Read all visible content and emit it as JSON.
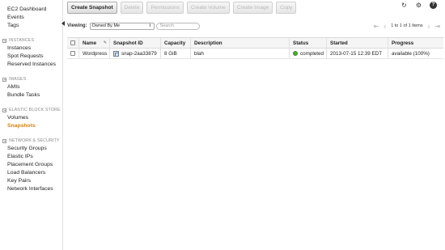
{
  "sidebar": {
    "top_items": [
      {
        "label": "EC2 Dashboard"
      },
      {
        "label": "Events"
      },
      {
        "label": "Tags"
      }
    ],
    "sections": [
      {
        "title": "INSTANCES",
        "items": [
          "Instances",
          "Spot Requests",
          "Reserved Instances"
        ]
      },
      {
        "title": "IMAGES",
        "items": [
          "AMIs",
          "Bundle Tasks"
        ]
      },
      {
        "title": "ELASTIC BLOCK STORE",
        "items": [
          "Volumes",
          "Snapshots"
        ]
      },
      {
        "title": "NETWORK & SECURITY",
        "items": [
          "Security Groups",
          "Elastic IPs",
          "Placement Groups",
          "Load Balancers",
          "Key Pairs",
          "Network Interfaces"
        ]
      }
    ],
    "active_item": "Snapshots"
  },
  "toolbar": {
    "create_snapshot": "Create Snapshot",
    "delete": "Delete",
    "permissions": "Permissions",
    "create_volume": "Create Volume",
    "create_image": "Create Image",
    "copy": "Copy",
    "icons": [
      "refresh-icon",
      "gear-icon",
      "help-icon"
    ],
    "help_glyph": "?"
  },
  "filter": {
    "viewing_label": "Viewing:",
    "viewing_value": "Owned By Me",
    "search_placeholder": "Search",
    "pager_text": "1 to 1 of 1 Items"
  },
  "table": {
    "columns": [
      "Name",
      "Snapshot ID",
      "Capacity",
      "Description",
      "Status",
      "Started",
      "Progress"
    ],
    "rows": [
      {
        "name": "Wordpress",
        "snapshot_id": "snap-2aa33879",
        "capacity": "8 GiB",
        "description": "blah",
        "status": "completed",
        "started": "2013-07-15 12:39 EDT",
        "progress": "available (100%)"
      }
    ]
  },
  "colors": {
    "active_nav": "#d5800d",
    "status_ok": "#4caf33"
  }
}
